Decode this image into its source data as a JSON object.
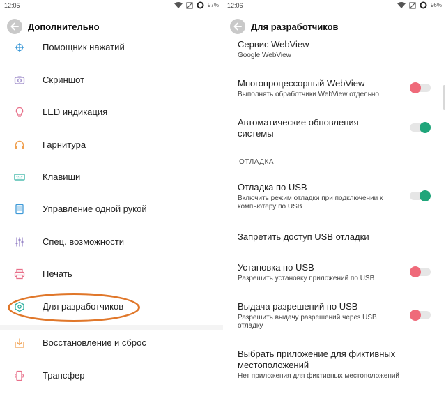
{
  "colors": {
    "accent_oval": "#e0772a",
    "toggle_on": "#1fa57a",
    "toggle_off": "#ef6a7a"
  },
  "left": {
    "status": {
      "time": "12:05",
      "battery": "97%"
    },
    "title": "Дополнительно",
    "items": [
      {
        "label": "Помощник нажатий",
        "icon": "crosshair-icon"
      },
      {
        "label": "Скриншот",
        "icon": "camera-icon"
      },
      {
        "label": "LED индикация",
        "icon": "lightbulb-icon"
      },
      {
        "label": "Гарнитура",
        "icon": "headphones-icon"
      },
      {
        "label": "Клавиши",
        "icon": "keyboard-icon"
      },
      {
        "label": "Управление одной рукой",
        "icon": "phone-frame-icon"
      },
      {
        "label": "Спец. возможности",
        "icon": "sliders-icon"
      },
      {
        "label": "Печать",
        "icon": "printer-icon"
      },
      {
        "label": "Для разработчиков",
        "icon": "developer-hexagon-icon"
      },
      {
        "label": "Восстановление и сброс",
        "icon": "restore-icon"
      },
      {
        "label": "Трансфер",
        "icon": "transfer-icon"
      }
    ]
  },
  "right": {
    "status": {
      "time": "12:06",
      "battery": "96%"
    },
    "title": "Для разработчиков",
    "webview_service": {
      "title": "Сервис WebView",
      "sub": "Google WebView"
    },
    "multiprocess": {
      "title": "Многопроцессорный WebView",
      "sub": "Выполнять обработчики WebView отдельно",
      "enabled": false
    },
    "auto_updates": {
      "title_line1": "Автоматические обновления",
      "title_line2": "системы",
      "enabled": true
    },
    "section": "ОТЛАДКА",
    "usb_debug": {
      "title": "Отладка по USB",
      "sub_line1": "Включить режим отладки при подключении к",
      "sub_line2": "компьютеру по USB",
      "enabled": true
    },
    "revoke_usb": {
      "title": "Запретить доступ USB отладки"
    },
    "usb_install": {
      "title": "Установка по USB",
      "sub": "Разрешить установку приложений по USB",
      "enabled": false
    },
    "usb_perms": {
      "title": "Выдача разрешений по USB",
      "sub_line1": "Разрешить выдачу разрешений через USB",
      "sub_line2": "отладку",
      "enabled": false
    },
    "mock_location": {
      "title_line1": "Выбрать приложение для фиктивных",
      "title_line2": "местоположений",
      "sub": "Нет приложения для фиктивных местоположений"
    }
  }
}
